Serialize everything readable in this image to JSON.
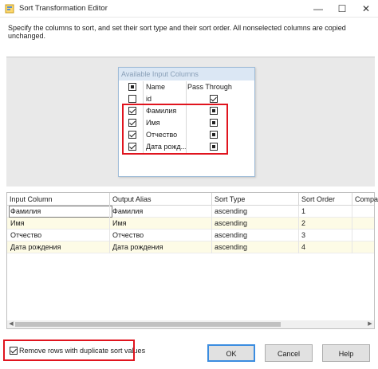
{
  "window": {
    "title": "Sort Transformation Editor",
    "minimize_glyph": "—",
    "maximize_glyph": "☐",
    "close_glyph": "✕"
  },
  "instruction": "Specify the columns to sort, and set their sort type and their sort order. All nonselected columns are copied unchanged.",
  "available": {
    "title": "Available Input Columns",
    "header_name": "Name",
    "header_pass": "Pass Through",
    "rows": [
      {
        "name": "id",
        "checked": false,
        "pass_through": true
      },
      {
        "name": "Фамилия",
        "checked": true,
        "pass_through": true
      },
      {
        "name": "Имя",
        "checked": true,
        "pass_through": true
      },
      {
        "name": "Отчество",
        "checked": true,
        "pass_through": true
      },
      {
        "name": "Дата рожд...",
        "checked": true,
        "pass_through": true
      }
    ]
  },
  "grid": {
    "columns": [
      "Input Column",
      "Output Alias",
      "Sort Type",
      "Sort Order",
      "Compa"
    ],
    "rows": [
      {
        "input": "Фамилия",
        "alias": "Фамилия",
        "type": "ascending",
        "order": "1"
      },
      {
        "input": "Имя",
        "alias": "Имя",
        "type": "ascending",
        "order": "2"
      },
      {
        "input": "Отчество",
        "alias": "Отчество",
        "type": "ascending",
        "order": "3"
      },
      {
        "input": "Дата рождения",
        "alias": "Дата рождения",
        "type": "ascending",
        "order": "4"
      }
    ]
  },
  "remove_duplicates": {
    "label": "Remove rows with duplicate sort values",
    "checked": true
  },
  "buttons": {
    "ok": "OK",
    "cancel": "Cancel",
    "help": "Help"
  },
  "colors": {
    "highlight_red": "#e0141e",
    "primary_button_border": "#3b8de0",
    "alt_row": "#fdfbe6"
  }
}
